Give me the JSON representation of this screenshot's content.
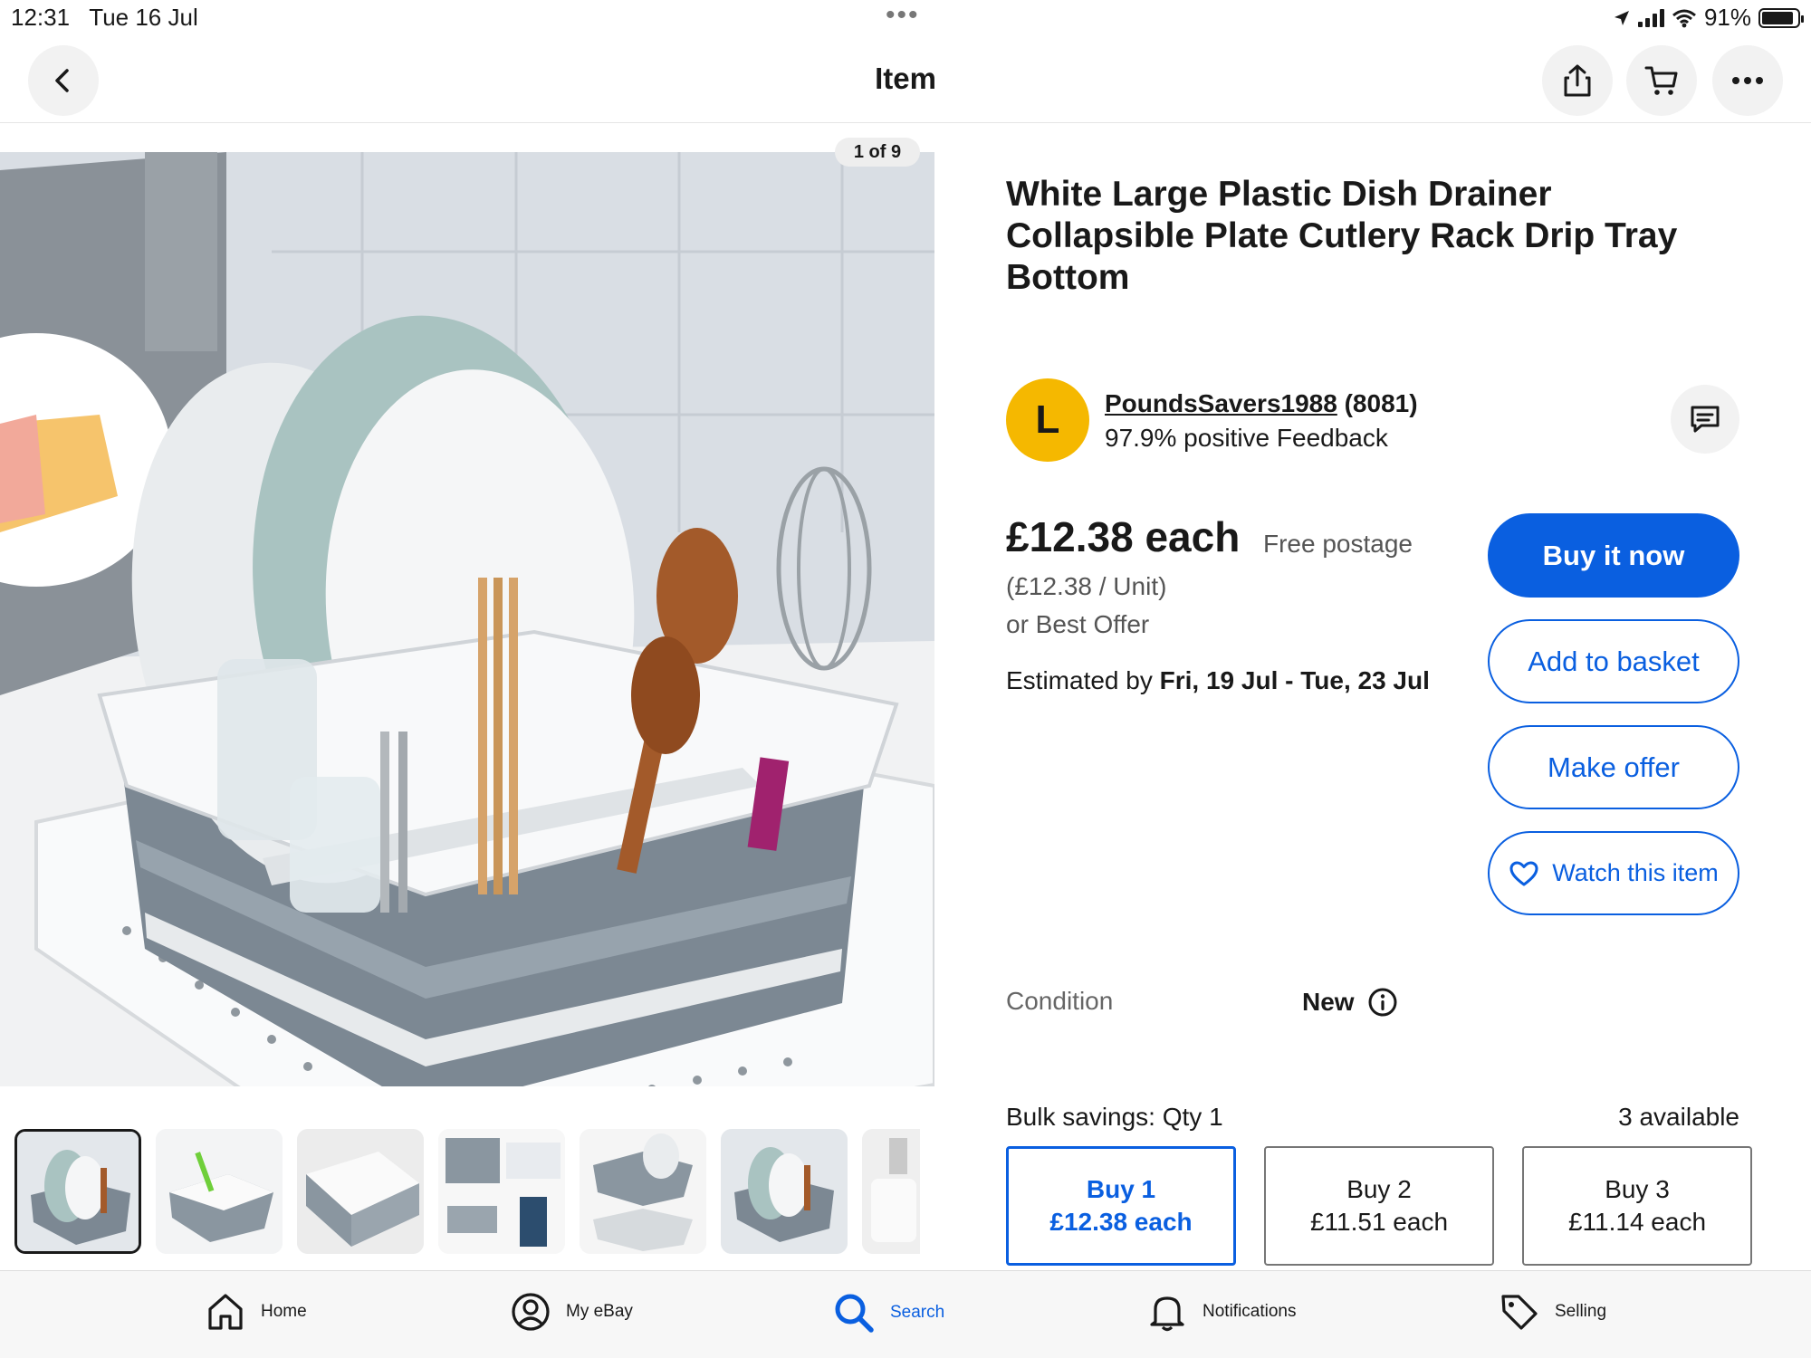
{
  "status_bar": {
    "time": "12:31",
    "date": "Tue 16 Jul",
    "battery": "91%"
  },
  "header": {
    "title": "Item"
  },
  "gallery": {
    "counter": "1 of 9",
    "thumbnail_count_visible": 6
  },
  "product": {
    "title": "White Large Plastic Dish Drainer Collapsible Plate Cutlery Rack Drip Tray Bottom"
  },
  "seller": {
    "initial": "L",
    "name": "PoundsSavers1988",
    "score": "(8081)",
    "feedback": "97.9% positive Feedback"
  },
  "pricing": {
    "price": "£12.38 each",
    "postage": "Free postage",
    "unit_price": "(£12.38 / Unit)",
    "best_offer": "or Best Offer",
    "estimate_prefix": "Estimated by",
    "estimate_dates": "Fri, 19 Jul - Tue, 23 Jul"
  },
  "actions": {
    "buy_now": "Buy it now",
    "add_to_basket": "Add to basket",
    "make_offer": "Make offer",
    "watch": "Watch this item"
  },
  "condition": {
    "label": "Condition",
    "value": "New"
  },
  "bulk": {
    "label": "Bulk savings: Qty 1",
    "available": "3 available",
    "tiers": [
      {
        "qty": "Buy 1",
        "price": "£12.38 each"
      },
      {
        "qty": "Buy 2",
        "price": "£11.51 each"
      },
      {
        "qty": "Buy 3",
        "price": "£11.14 each"
      }
    ]
  },
  "tabs": [
    {
      "label": "Home"
    },
    {
      "label": "My eBay"
    },
    {
      "label": "Search"
    },
    {
      "label": "Notifications"
    },
    {
      "label": "Selling"
    }
  ],
  "colors": {
    "accent": "#0a5fe0",
    "avatar": "#f5b800",
    "text": "#191919"
  }
}
